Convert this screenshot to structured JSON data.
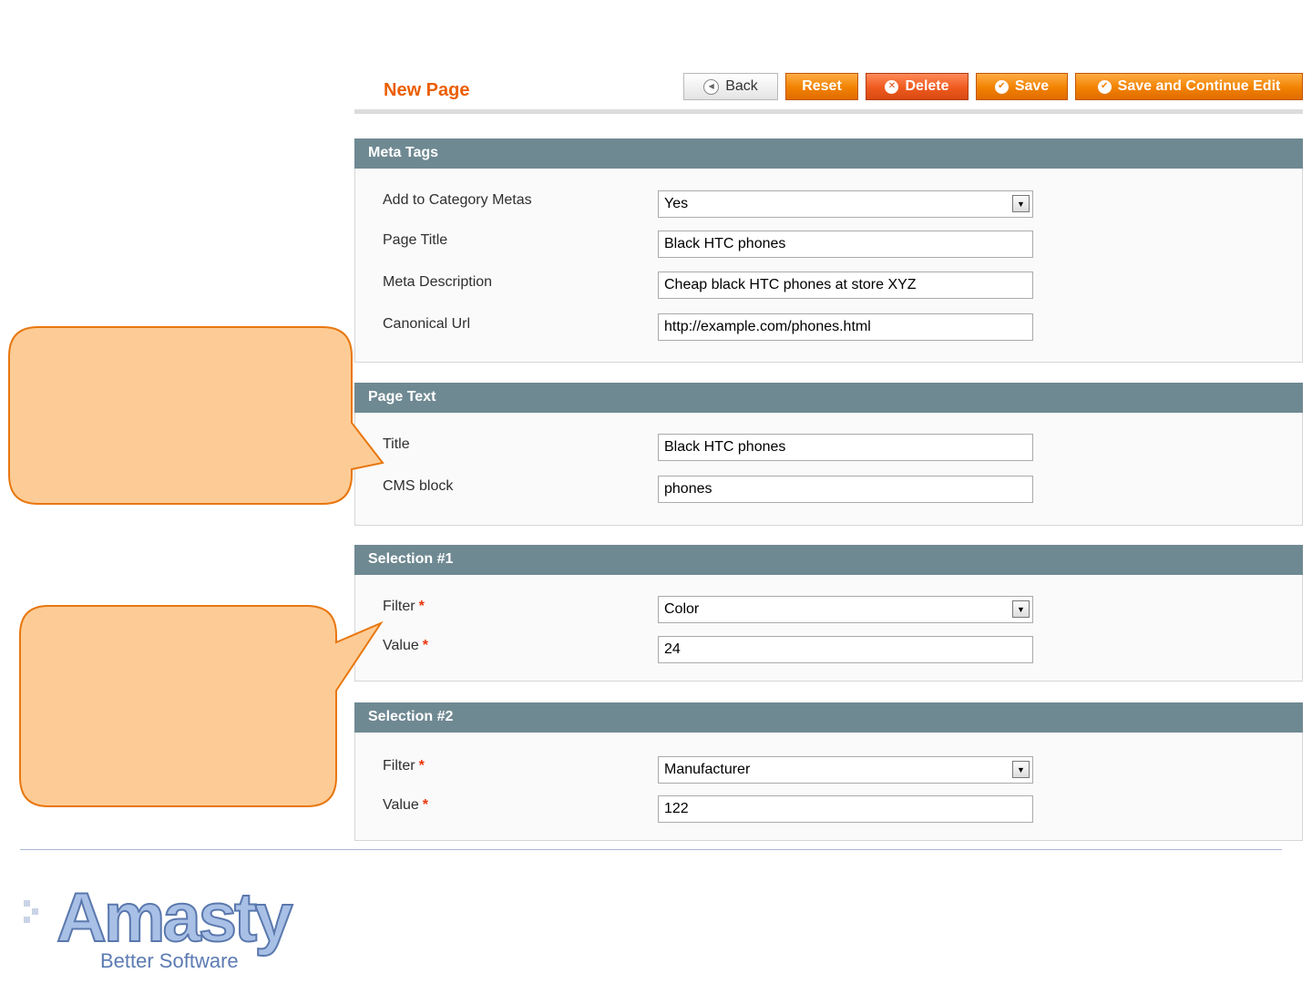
{
  "header": {
    "title": "New Page",
    "buttons": {
      "back": "Back",
      "reset": "Reset",
      "delete": "Delete",
      "save": "Save",
      "save_continue": "Save and Continue Edit"
    }
  },
  "sections": {
    "meta_tags": {
      "title": "Meta Tags",
      "add_to_category_label": "Add to Category Metas",
      "add_to_category_value": "Yes",
      "page_title_label": "Page Title",
      "page_title_value": "Black HTC phones",
      "meta_description_label": "Meta Description",
      "meta_description_value": "Cheap black HTC phones at store XYZ",
      "canonical_url_label": "Canonical Url",
      "canonical_url_value": "http://example.com/phones.html"
    },
    "page_text": {
      "title": "Page Text",
      "title_label": "Title",
      "title_value": "Black HTC phones",
      "cms_block_label": "CMS block",
      "cms_block_value": "phones"
    },
    "selection_1": {
      "title": "Selection #1",
      "filter_label": "Filter",
      "filter_value": "Color",
      "value_label": "Value",
      "value_value": "24"
    },
    "selection_2": {
      "title": "Selection #2",
      "filter_label": "Filter",
      "filter_value": "Manufacturer",
      "value_label": "Value",
      "value_value": "122"
    },
    "required_mark": "*"
  },
  "footer": {
    "logo_name": "Amasty",
    "logo_tagline": "Better Software"
  },
  "colors": {
    "accent": "#eb5e00",
    "section_header": "#6f8992",
    "callout_fill": "#fdcc96",
    "callout_border": "#e8770f"
  }
}
